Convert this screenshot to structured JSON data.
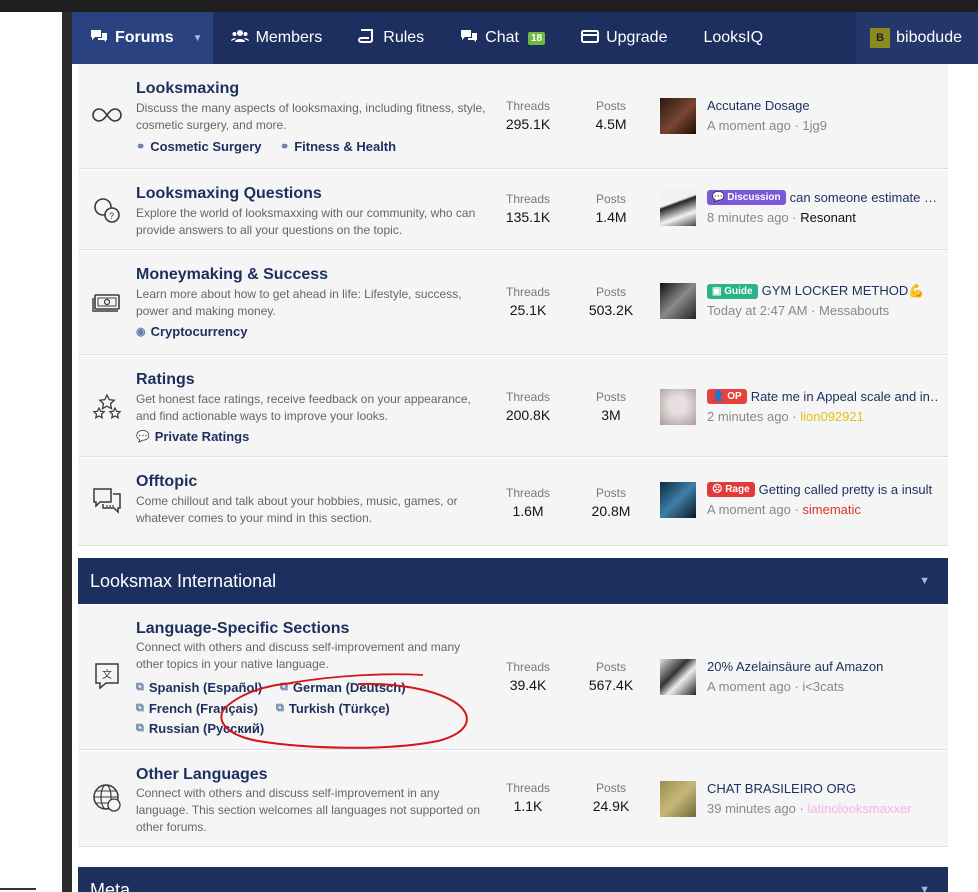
{
  "nav": {
    "forums": "Forums",
    "members": "Members",
    "rules": "Rules",
    "chat": "Chat",
    "chat_badge": "18",
    "upgrade": "Upgrade",
    "looksiq": "LooksIQ",
    "user_initial": "B",
    "username": "bibodude"
  },
  "labels": {
    "threads": "Threads",
    "posts": "Posts"
  },
  "nodes": [
    {
      "title": "Looksmaxing",
      "desc": "Discuss the many aspects of looksmaxing, including fitness, style, cosmetic surgery, and more.",
      "subs": [
        "Cosmetic Surgery",
        "Fitness & Health"
      ],
      "threads": "295.1K",
      "posts": "4.5M",
      "last_title": "Accutane Dosage",
      "last_time": "A moment ago",
      "last_user": "1jg9"
    },
    {
      "title": "Looksmaxing Questions",
      "desc": "Explore the world of looksmaxxing with our community, who can provide answers to all your questions on the topic.",
      "threads": "135.1K",
      "posts": "1.4M",
      "last_prefix": "Discussion",
      "last_title": "can someone estimate …",
      "last_time": "8 minutes ago",
      "last_user": "Resonant"
    },
    {
      "title": "Moneymaking & Success",
      "desc": "Learn more about how to get ahead in life: Lifestyle, success, power and making money.",
      "subs": [
        "Cryptocurrency"
      ],
      "threads": "25.1K",
      "posts": "503.2K",
      "last_prefix": "Guide",
      "last_title": "GYM LOCKER METHOD💪",
      "last_time": "Today at 2:47 AM",
      "last_user": "Messabouts"
    },
    {
      "title": "Ratings",
      "desc": "Get honest face ratings, receive feedback on your appearance, and find actionable ways to improve your looks.",
      "subs": [
        "Private Ratings"
      ],
      "threads": "200.8K",
      "posts": "3M",
      "last_prefix": "OP",
      "last_title": "Rate me in Appeal scale and in…",
      "last_time": "2 minutes ago",
      "last_user": "lion092921"
    },
    {
      "title": "Offtopic",
      "desc": "Come chillout and talk about your hobbies, music, games, or whatever comes to your mind in this section.",
      "threads": "1.6M",
      "posts": "20.8M",
      "last_prefix": "Rage",
      "last_title": "Getting called pretty is a insult",
      "last_time": "A moment ago",
      "last_user": "simematic"
    }
  ],
  "category": {
    "title": "Looksmax International"
  },
  "intl_nodes": [
    {
      "title": "Language-Specific Sections",
      "desc": "Connect with others and discuss self-improvement and many other topics in your native language.",
      "subs": [
        "Spanish (Español)",
        "German (Deutsch)",
        "French (Français)",
        "Turkish (Türkçe)",
        "Russian (Русский)"
      ],
      "threads": "39.4K",
      "posts": "567.4K",
      "last_title": "20% Azelainsäure auf Amazon",
      "last_time": "A moment ago",
      "last_user": "i<3cats"
    },
    {
      "title": "Other Languages",
      "desc": "Connect with others and discuss self-improvement in any language. This section welcomes all languages not supported on other forums.",
      "threads": "1.1K",
      "posts": "24.9K",
      "last_title": "CHAT BRASILEIRO ORG",
      "last_time": "39 minutes ago",
      "last_user": "latinolooksmaxxer"
    }
  ],
  "next_category": {
    "title": "Meta"
  },
  "colors": {
    "nav_bg": "#1c2f5e",
    "discussion_prefix": "#7b58d6",
    "guide_prefix": "#2bb389",
    "op_prefix": "#e8413c",
    "rage_prefix": "#e03a3a",
    "user_lion": "#e3c210",
    "user_simematic": "#d9342c",
    "user_latino": "#f3b6e8",
    "annotation": "#d4161b"
  }
}
